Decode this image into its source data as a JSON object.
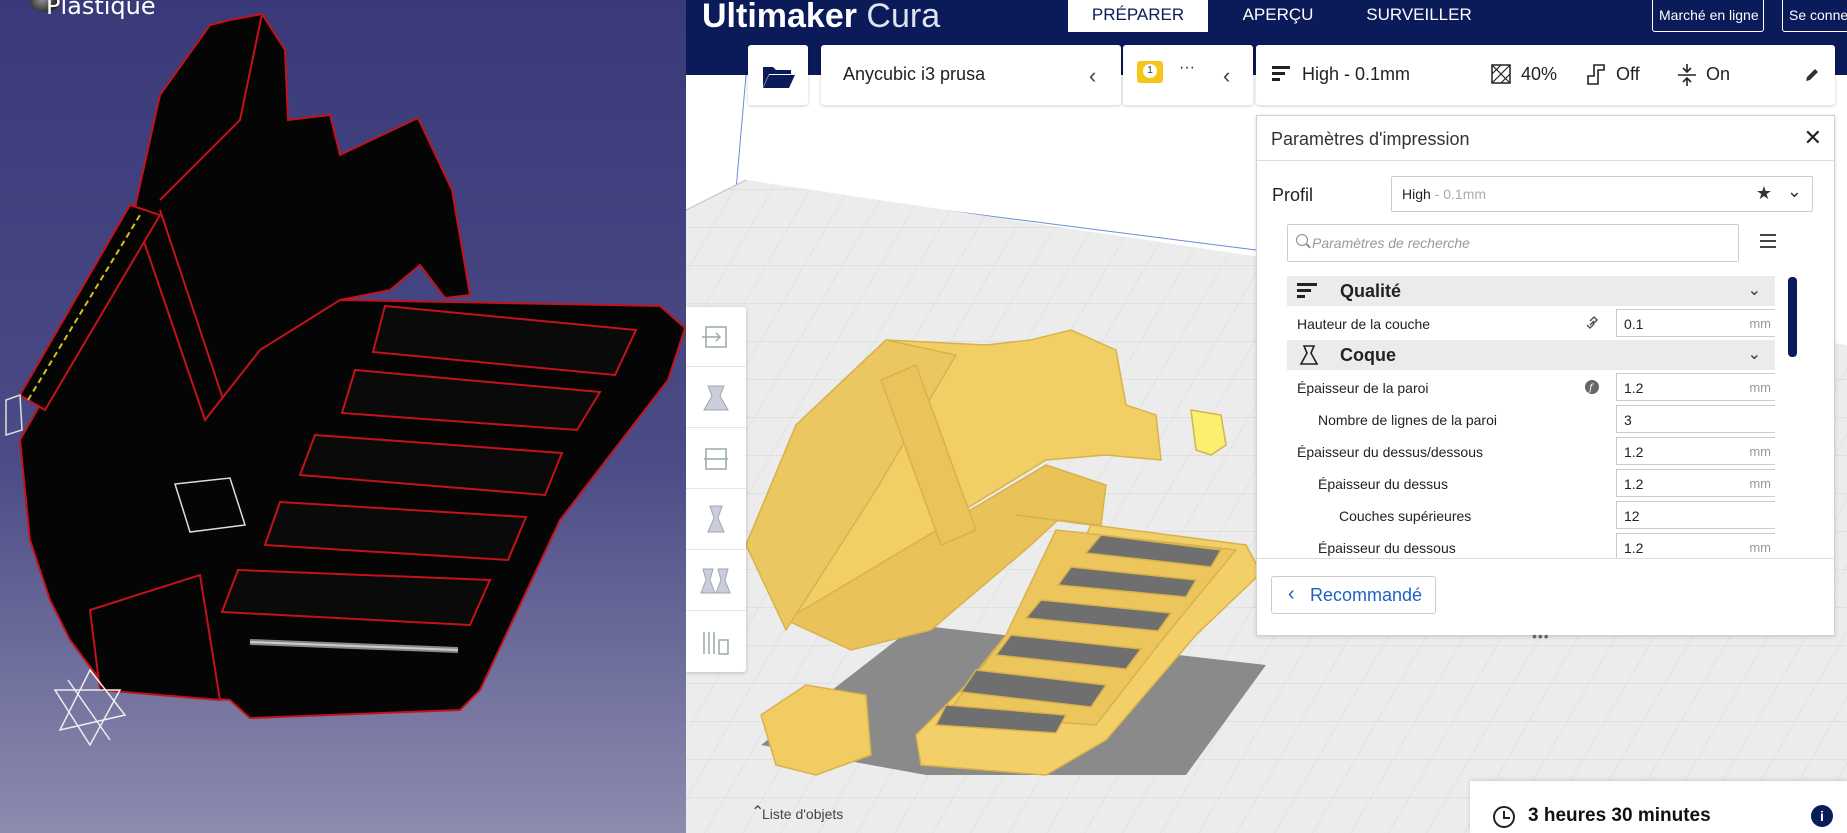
{
  "cad": {
    "material_label": "Plastique"
  },
  "cura": {
    "logo_bold": "Ultimaker",
    "logo_light": "Cura",
    "stages": [
      "PRÉPARER",
      "APERÇU",
      "SURVEILLER"
    ],
    "marketplace": "Marché en ligne",
    "signin": "Se connec",
    "printer_name": "Anycubic i3 prusa",
    "extruder_badge": "1",
    "extruder_more": "···",
    "profile_summary": "High - 0.1mm",
    "infill": "40%",
    "support": "Off",
    "adhesion": "On",
    "settings_panel": {
      "title": "Paramètres d'impression",
      "profile_label": "Profil",
      "profile_name": "High",
      "profile_suffix": " - 0.1mm",
      "search_placeholder": "Paramètres de recherche",
      "categories": [
        {
          "name": "Qualité"
        },
        {
          "name": "Coque"
        }
      ],
      "rows": [
        {
          "label": "Hauteur de la couche",
          "value": "0.1",
          "unit": "mm"
        },
        {
          "label": "Épaisseur de la paroi",
          "value": "1.2",
          "unit": "mm"
        },
        {
          "label": "Nombre de lignes de la paroi",
          "value": "3",
          "unit": ""
        },
        {
          "label": "Épaisseur du dessus/dessous",
          "value": "1.2",
          "unit": "mm"
        },
        {
          "label": "Épaisseur du dessus",
          "value": "1.2",
          "unit": "mm"
        },
        {
          "label": "Couches supérieures",
          "value": "12",
          "unit": ""
        },
        {
          "label": "Épaisseur du dessous",
          "value": "1.2",
          "unit": "mm"
        }
      ],
      "recommended_button": "Recommandé",
      "dots": "•••"
    },
    "object_list": "Liste d'objets",
    "print_time": "3 heures 30 minutes",
    "colors": {
      "header": "#0b1a58",
      "accent": "#1f61c6",
      "model": "#f7d66a"
    }
  }
}
